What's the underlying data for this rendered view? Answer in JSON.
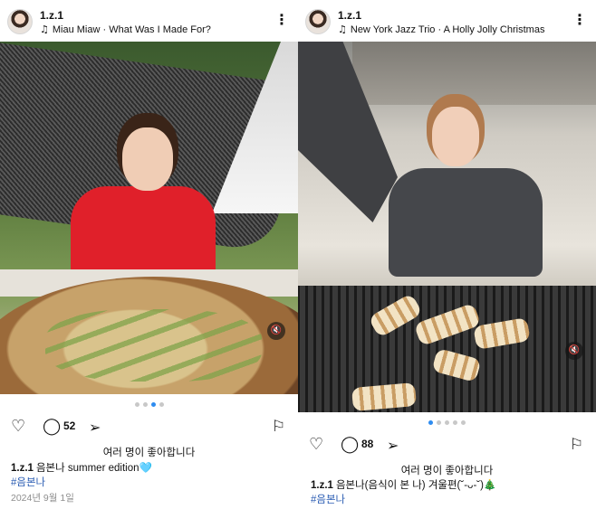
{
  "posts": [
    {
      "username": "1.z.1",
      "music_icon": "music-note-icon",
      "music": "Miau Miaw · What Was I Made For?",
      "more_icon": "more-vertical-icon",
      "comment_count": "52",
      "likes_text": "여러 명이 좋아합니다",
      "caption_user": "1.z.1",
      "caption_text": "음본나 summer edition🩵",
      "hashtag": "#음본나",
      "date": "2024년 9월 1일",
      "carousel": {
        "count": 4,
        "active_index": 2
      }
    },
    {
      "username": "1.z.1",
      "music_icon": "music-note-icon",
      "music": "New York Jazz Trio · A Holly Jolly Christmas",
      "more_icon": "more-vertical-icon",
      "comment_count": "88",
      "likes_text": "여러 명이 좋아합니다",
      "caption_user": "1.z.1",
      "caption_text": "음본나(음식이 본 나) 겨울편(˘-ᴗ-˘)🎄",
      "hashtag": "#음본나",
      "carousel": {
        "count": 5,
        "active_index": 0
      }
    }
  ],
  "icons": {
    "heart": "♡",
    "comment": "◯",
    "share": "➢",
    "bookmark": "⚐",
    "mute": "🔇",
    "music": "♫",
    "more": "⋮"
  },
  "colors": {
    "active_dot": "#2e8cf0",
    "hashtag": "#2b5db3",
    "date": "#8e8e8e"
  }
}
